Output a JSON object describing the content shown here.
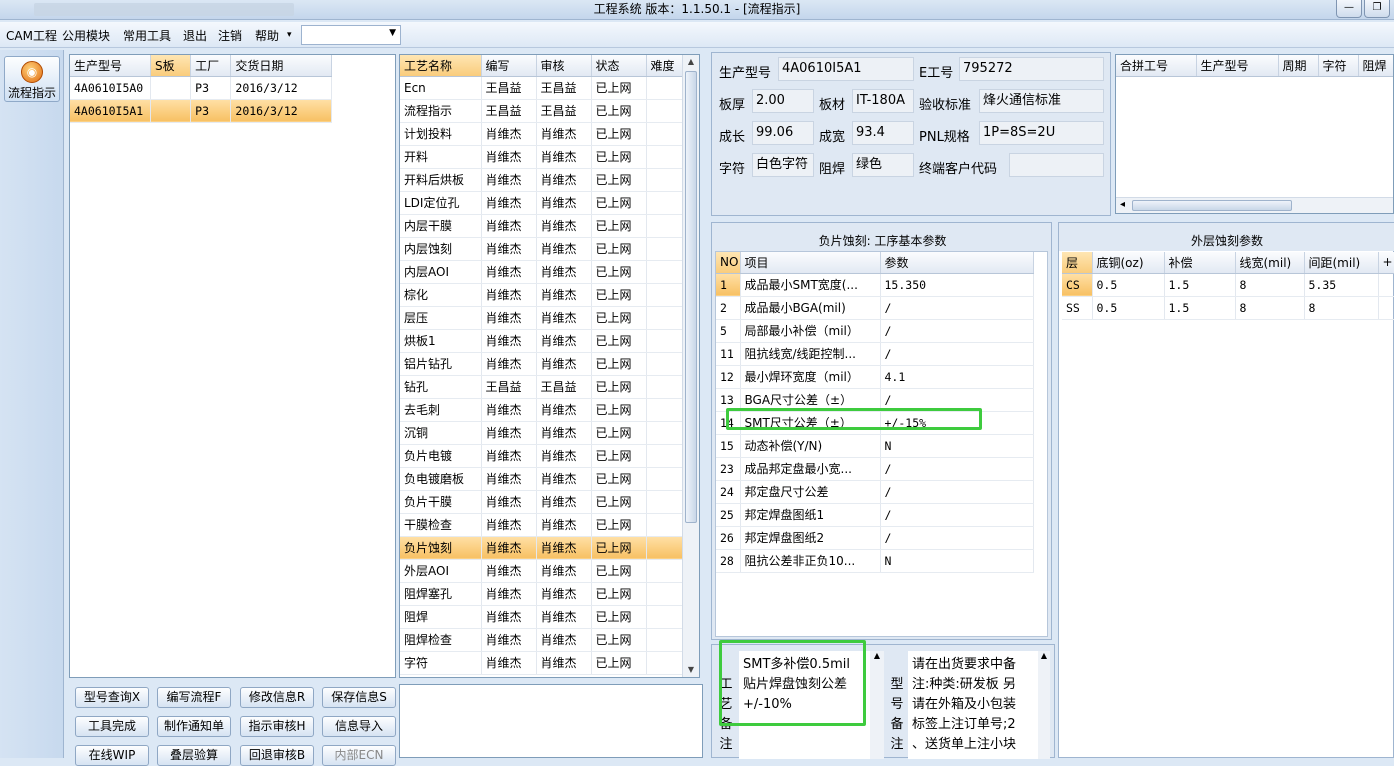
{
  "window": {
    "title": "工程系统   版本：1.1.50.1 - [流程指示]",
    "min": "—",
    "restore": "❐"
  },
  "menu": {
    "items": [
      "CAM工程",
      "公用模块",
      "常用工具",
      "退出",
      "注销",
      "帮助"
    ],
    "help_arrow": "▾",
    "combo_value": ""
  },
  "nav": {
    "flow_label": "流程指示"
  },
  "models": {
    "columns": [
      "生产型号",
      "S板",
      "工厂",
      "交货日期"
    ],
    "rows": [
      {
        "model": "4A0610I5A0",
        "s": "",
        "factory": "P3",
        "date": "2016/3/12"
      },
      {
        "model": "4A0610I5A1",
        "s": "",
        "factory": "P3",
        "date": "2016/3/12"
      }
    ]
  },
  "process": {
    "columns": [
      "工艺名称",
      "编写",
      "审核",
      "状态",
      "难度"
    ],
    "rows": [
      [
        "Ecn",
        "王昌益",
        "王昌益",
        "已上网"
      ],
      [
        "流程指示",
        "王昌益",
        "王昌益",
        "已上网"
      ],
      [
        "计划投料",
        "肖维杰",
        "肖维杰",
        "已上网"
      ],
      [
        "开料",
        "肖维杰",
        "肖维杰",
        "已上网"
      ],
      [
        "开料后烘板",
        "肖维杰",
        "肖维杰",
        "已上网"
      ],
      [
        "LDI定位孔",
        "肖维杰",
        "肖维杰",
        "已上网"
      ],
      [
        "内层干膜",
        "肖维杰",
        "肖维杰",
        "已上网"
      ],
      [
        "内层蚀刻",
        "肖维杰",
        "肖维杰",
        "已上网"
      ],
      [
        "内层AOI",
        "肖维杰",
        "肖维杰",
        "已上网"
      ],
      [
        "棕化",
        "肖维杰",
        "肖维杰",
        "已上网"
      ],
      [
        "层压",
        "肖维杰",
        "肖维杰",
        "已上网"
      ],
      [
        "烘板1",
        "肖维杰",
        "肖维杰",
        "已上网"
      ],
      [
        "铝片钻孔",
        "肖维杰",
        "肖维杰",
        "已上网"
      ],
      [
        "钻孔",
        "王昌益",
        "王昌益",
        "已上网"
      ],
      [
        "去毛刺",
        "肖维杰",
        "肖维杰",
        "已上网"
      ],
      [
        "沉铜",
        "肖维杰",
        "肖维杰",
        "已上网"
      ],
      [
        "负片电镀",
        "肖维杰",
        "肖维杰",
        "已上网"
      ],
      [
        "负电镀磨板",
        "肖维杰",
        "肖维杰",
        "已上网"
      ],
      [
        "负片干膜",
        "肖维杰",
        "肖维杰",
        "已上网"
      ],
      [
        "干膜检查",
        "肖维杰",
        "肖维杰",
        "已上网"
      ],
      [
        "负片蚀刻",
        "肖维杰",
        "肖维杰",
        "已上网"
      ],
      [
        "外层AOI",
        "肖维杰",
        "肖维杰",
        "已上网"
      ],
      [
        "阻焊塞孔",
        "肖维杰",
        "肖维杰",
        "已上网"
      ],
      [
        "阻焊",
        "肖维杰",
        "肖维杰",
        "已上网"
      ],
      [
        "阻焊检查",
        "肖维杰",
        "肖维杰",
        "已上网"
      ],
      [
        "字符",
        "肖维杰",
        "肖维杰",
        "已上网"
      ]
    ],
    "selected": "负片蚀刻"
  },
  "buttons": {
    "row1": [
      "型号查询X",
      "编写流程F",
      "修改信息R",
      "保存信息S"
    ],
    "row2": [
      "工具完成",
      "制作通知单",
      "指示审核H",
      "信息导入"
    ],
    "row3": [
      "在线WIP",
      "叠层验算",
      "回退审核B",
      "内部ECN"
    ]
  },
  "info": {
    "model_label": "生产型号",
    "model": "4A0610I5A1",
    "e_label": "E工号",
    "e": "795272",
    "thick_label": "板厚",
    "thick": "2.00",
    "material_label": "板材",
    "material": "IT-180A",
    "accept_label": "验收标准",
    "accept": "烽火通信标准",
    "len_label": "成长",
    "len": "99.06",
    "width_label": "成宽",
    "width": "93.4",
    "pnl_label": "PNL规格",
    "pnl": "1P=8S=2U",
    "char_label": "字符",
    "char": "白色字符",
    "mask_label": "阻焊",
    "mask": "绿色",
    "cust_label": "终端客户代码",
    "cust": ""
  },
  "merge": {
    "columns": [
      "合拼工号",
      "生产型号",
      "周期",
      "字符",
      "阻焊"
    ],
    "scroll_left": "◂",
    "scroll_right": "▸"
  },
  "params": {
    "title": "负片蚀刻: 工序基本参数",
    "columns": [
      "NO",
      "项目",
      "参数"
    ],
    "rows": [
      [
        "1",
        "成品最小SMT宽度(...",
        "15.350"
      ],
      [
        "2",
        "成品最小BGA(mil)",
        "/"
      ],
      [
        "5",
        "局部最小补偿（mil）",
        "/"
      ],
      [
        "11",
        "阻抗线宽/线距控制...",
        "/"
      ],
      [
        "12",
        "最小焊环宽度（mil）",
        "4.1"
      ],
      [
        "13",
        "BGA尺寸公差（±）",
        "/"
      ],
      [
        "14",
        "SMT尺寸公差（±）",
        "+/-15%"
      ],
      [
        "15",
        "动态补偿(Y/N)",
        "N"
      ],
      [
        "23",
        "成品邦定盘最小宽...",
        "/"
      ],
      [
        "24",
        "邦定盘尺寸公差",
        "/"
      ],
      [
        "25",
        "邦定焊盘图纸1",
        "/"
      ],
      [
        "26",
        "邦定焊盘图纸2",
        "/"
      ],
      [
        "28",
        "阻抗公差非正负10...",
        "N"
      ]
    ]
  },
  "outer": {
    "title": "外层蚀刻参数",
    "columns": [
      "层",
      "底铜(oz)",
      "补偿",
      "线宽(mil)",
      "间距(mil)",
      "+"
    ],
    "rows": [
      [
        "CS",
        "0.5",
        "1.5",
        "8",
        "5.35"
      ],
      [
        "SS",
        "0.5",
        "1.5",
        "8",
        "8"
      ]
    ]
  },
  "remark": {
    "label": "工艺备注",
    "lines": [
      "SMT多补偿0.5mil",
      "贴片焊盘蚀刻公差",
      "+/-10%"
    ]
  },
  "model_remark": {
    "label": "型号备注",
    "lines": [
      "请在出货要求中备",
      "注:种类:研发板 另",
      "请在外箱及小包装",
      "标签上注订单号;2",
      "、送货单上注小块"
    ]
  },
  "colors": {
    "selected_row": "#f7c063",
    "highlight_box": "#3ecb3e",
    "panel_bg": "#dfe8f3"
  }
}
